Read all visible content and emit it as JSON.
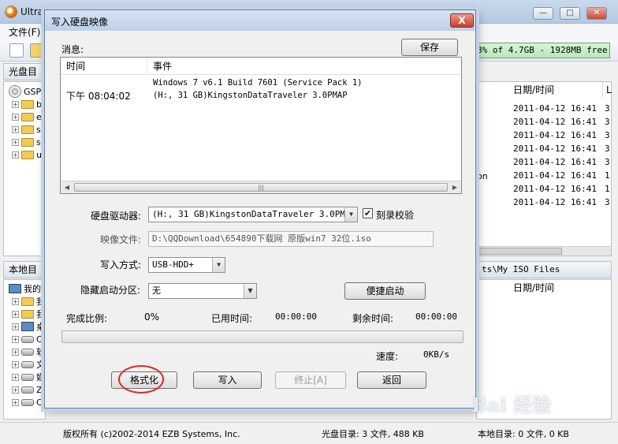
{
  "main_window": {
    "title": "Ultra",
    "menu": {
      "file": "文件(F)"
    },
    "capacity_text": "8% of 4.7GB - 1928MB free",
    "iso_pane": {
      "header": "光盘目录",
      "root_label": "GSP1",
      "folders": [
        "b",
        "e",
        "s",
        "s",
        "u"
      ]
    },
    "file_list": {
      "col_date": "日期/时间",
      "col_size": "L",
      "name_fragment": "on",
      "dates": [
        "2011-04-12 16:41",
        "2011-04-12 16:41",
        "2011-04-12 16:41",
        "2011-04-12 16:41",
        "2011-04-12 16:41",
        "2011-04-12 16:41",
        "2011-04-12 16:41",
        "2011-04-12 16:41"
      ],
      "sizes": [
        "3",
        "3",
        "3",
        "3",
        "3",
        "1",
        "1",
        "3"
      ]
    },
    "local_pane": {
      "header": "本地目录",
      "root_label": "我的",
      "path_fragment": "ts\\My ISO Files",
      "col_date": "日期/时间",
      "items": [
        "我",
        "我",
        "桌",
        "C",
        "软",
        "文",
        "娱",
        "Z",
        "C"
      ]
    },
    "status": {
      "copyright": "版权所有 (c)2002-2014 EZB Systems, Inc.",
      "iso_info": "光盘目录: 3 文件, 488 KB",
      "local_info": "本地目录: 0 文件, 0 KB"
    }
  },
  "dialog": {
    "title": "写入硬盘映像",
    "close_glyph": "X",
    "messages_label": "消息:",
    "save_button": "保存",
    "log": {
      "col_time": "时间",
      "col_event": "事件",
      "time": "下午 08:04:02",
      "event_line1": "Windows 7 v6.1 Build 7601 (Service Pack 1)",
      "event_line2": "(H:, 31 GB)KingstonDataTraveler 3.0PMAP"
    },
    "drive_label": "硬盘驱动器:",
    "drive_value": "(H:, 31 GB)KingstonDataTraveler 3.0PMAP",
    "verify_label": "刻录校验",
    "verify_checked": true,
    "image_label": "映像文件:",
    "image_value": "D:\\QQDownload\\654890下载网 原版win7 32位.iso",
    "method_label": "写入方式:",
    "method_value": "USB-HDD+",
    "hidden_label": "隐藏启动分区:",
    "hidden_value": "无",
    "quick_boot_button": "便捷启动",
    "progress_label": "完成比例:",
    "progress_value": "0%",
    "progress_fraction": 0,
    "elapsed_label": "已用时间:",
    "elapsed_value": "00:00:00",
    "remaining_label": "剩余时间:",
    "remaining_value": "00:00:00",
    "speed_label": "速度:",
    "speed_value": "0KB/s",
    "buttons": {
      "format": "格式化",
      "write": "写入",
      "stop": "终止[A]",
      "back": "返回"
    }
  },
  "watermark": "Bai 经验",
  "colors": {
    "highlight_circle": "#e0271f",
    "progress_green": "#3ebc3a"
  }
}
